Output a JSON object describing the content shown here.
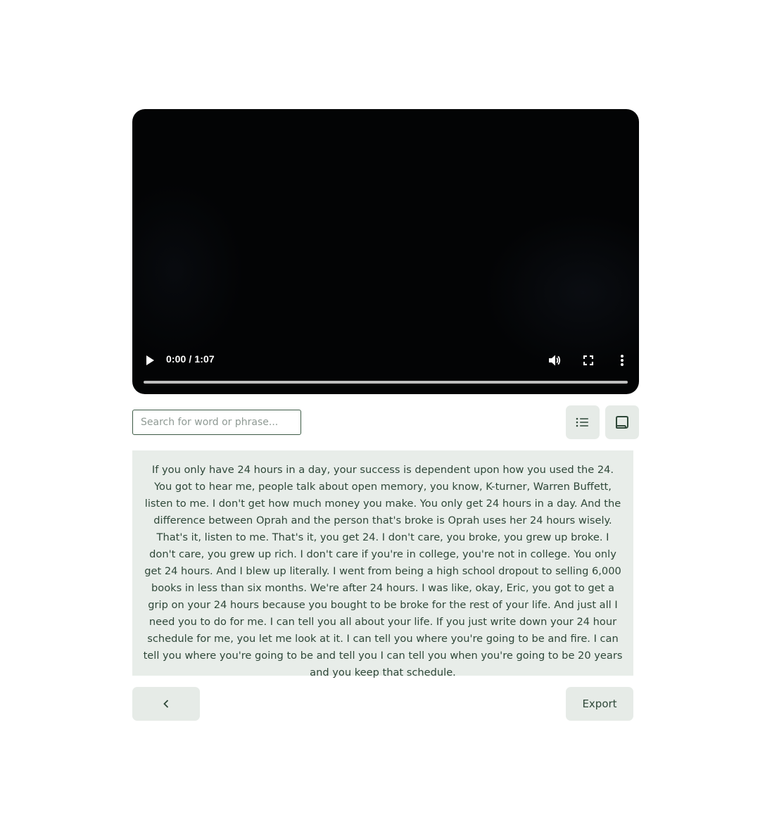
{
  "video": {
    "time_display": "0:00 / 1:07",
    "progress": 0,
    "controls": {
      "play_icon": "play-icon",
      "volume_icon": "volume-icon",
      "fullscreen_icon": "fullscreen-icon",
      "menu_icon": "more-vertical-icon"
    }
  },
  "search": {
    "placeholder": "Search for word or phrase..."
  },
  "view_toggles": {
    "list_icon": "list-icon",
    "transcript_icon": "scroll-icon"
  },
  "transcript": {
    "text": "If you only have 24 hours in a day, your success is dependent upon how you used the 24. You got to hear me, people talk about open memory, you know, K-turner, Warren Buffett, listen to me. I don't get how much money you make. You only get 24 hours in a day. And the difference between Oprah and the person that's broke is Oprah uses her 24 hours wisely. That's it, listen to me. That's it, you get 24. I don't care, you broke, you grew up broke. I don't care, you grew up rich. I don't care if you're in college, you're not in college. You only get 24 hours. And I blew up literally. I went from being a high school dropout to selling 6,000 books in less than six months. We're after 24 hours. I was like, okay, Eric, you got to get a grip on your 24 hours because you bought to be broke for the rest of your life. And just all I need you to do for me. I can tell you all about your life. If you just write down your 24 hour schedule for me, you let me look at it. I can tell you where you're going to be and fire. I can tell you where you're going to be and tell you I can tell you when you're going to be 20 years and you keep that schedule."
  },
  "footer": {
    "back_icon": "chevron-left-icon",
    "export_label": "Export"
  },
  "colors": {
    "accent": "#2e4738",
    "panel_bg": "#e8ede9",
    "button_bg": "#e6ebe7",
    "video_bg": "#030405"
  }
}
